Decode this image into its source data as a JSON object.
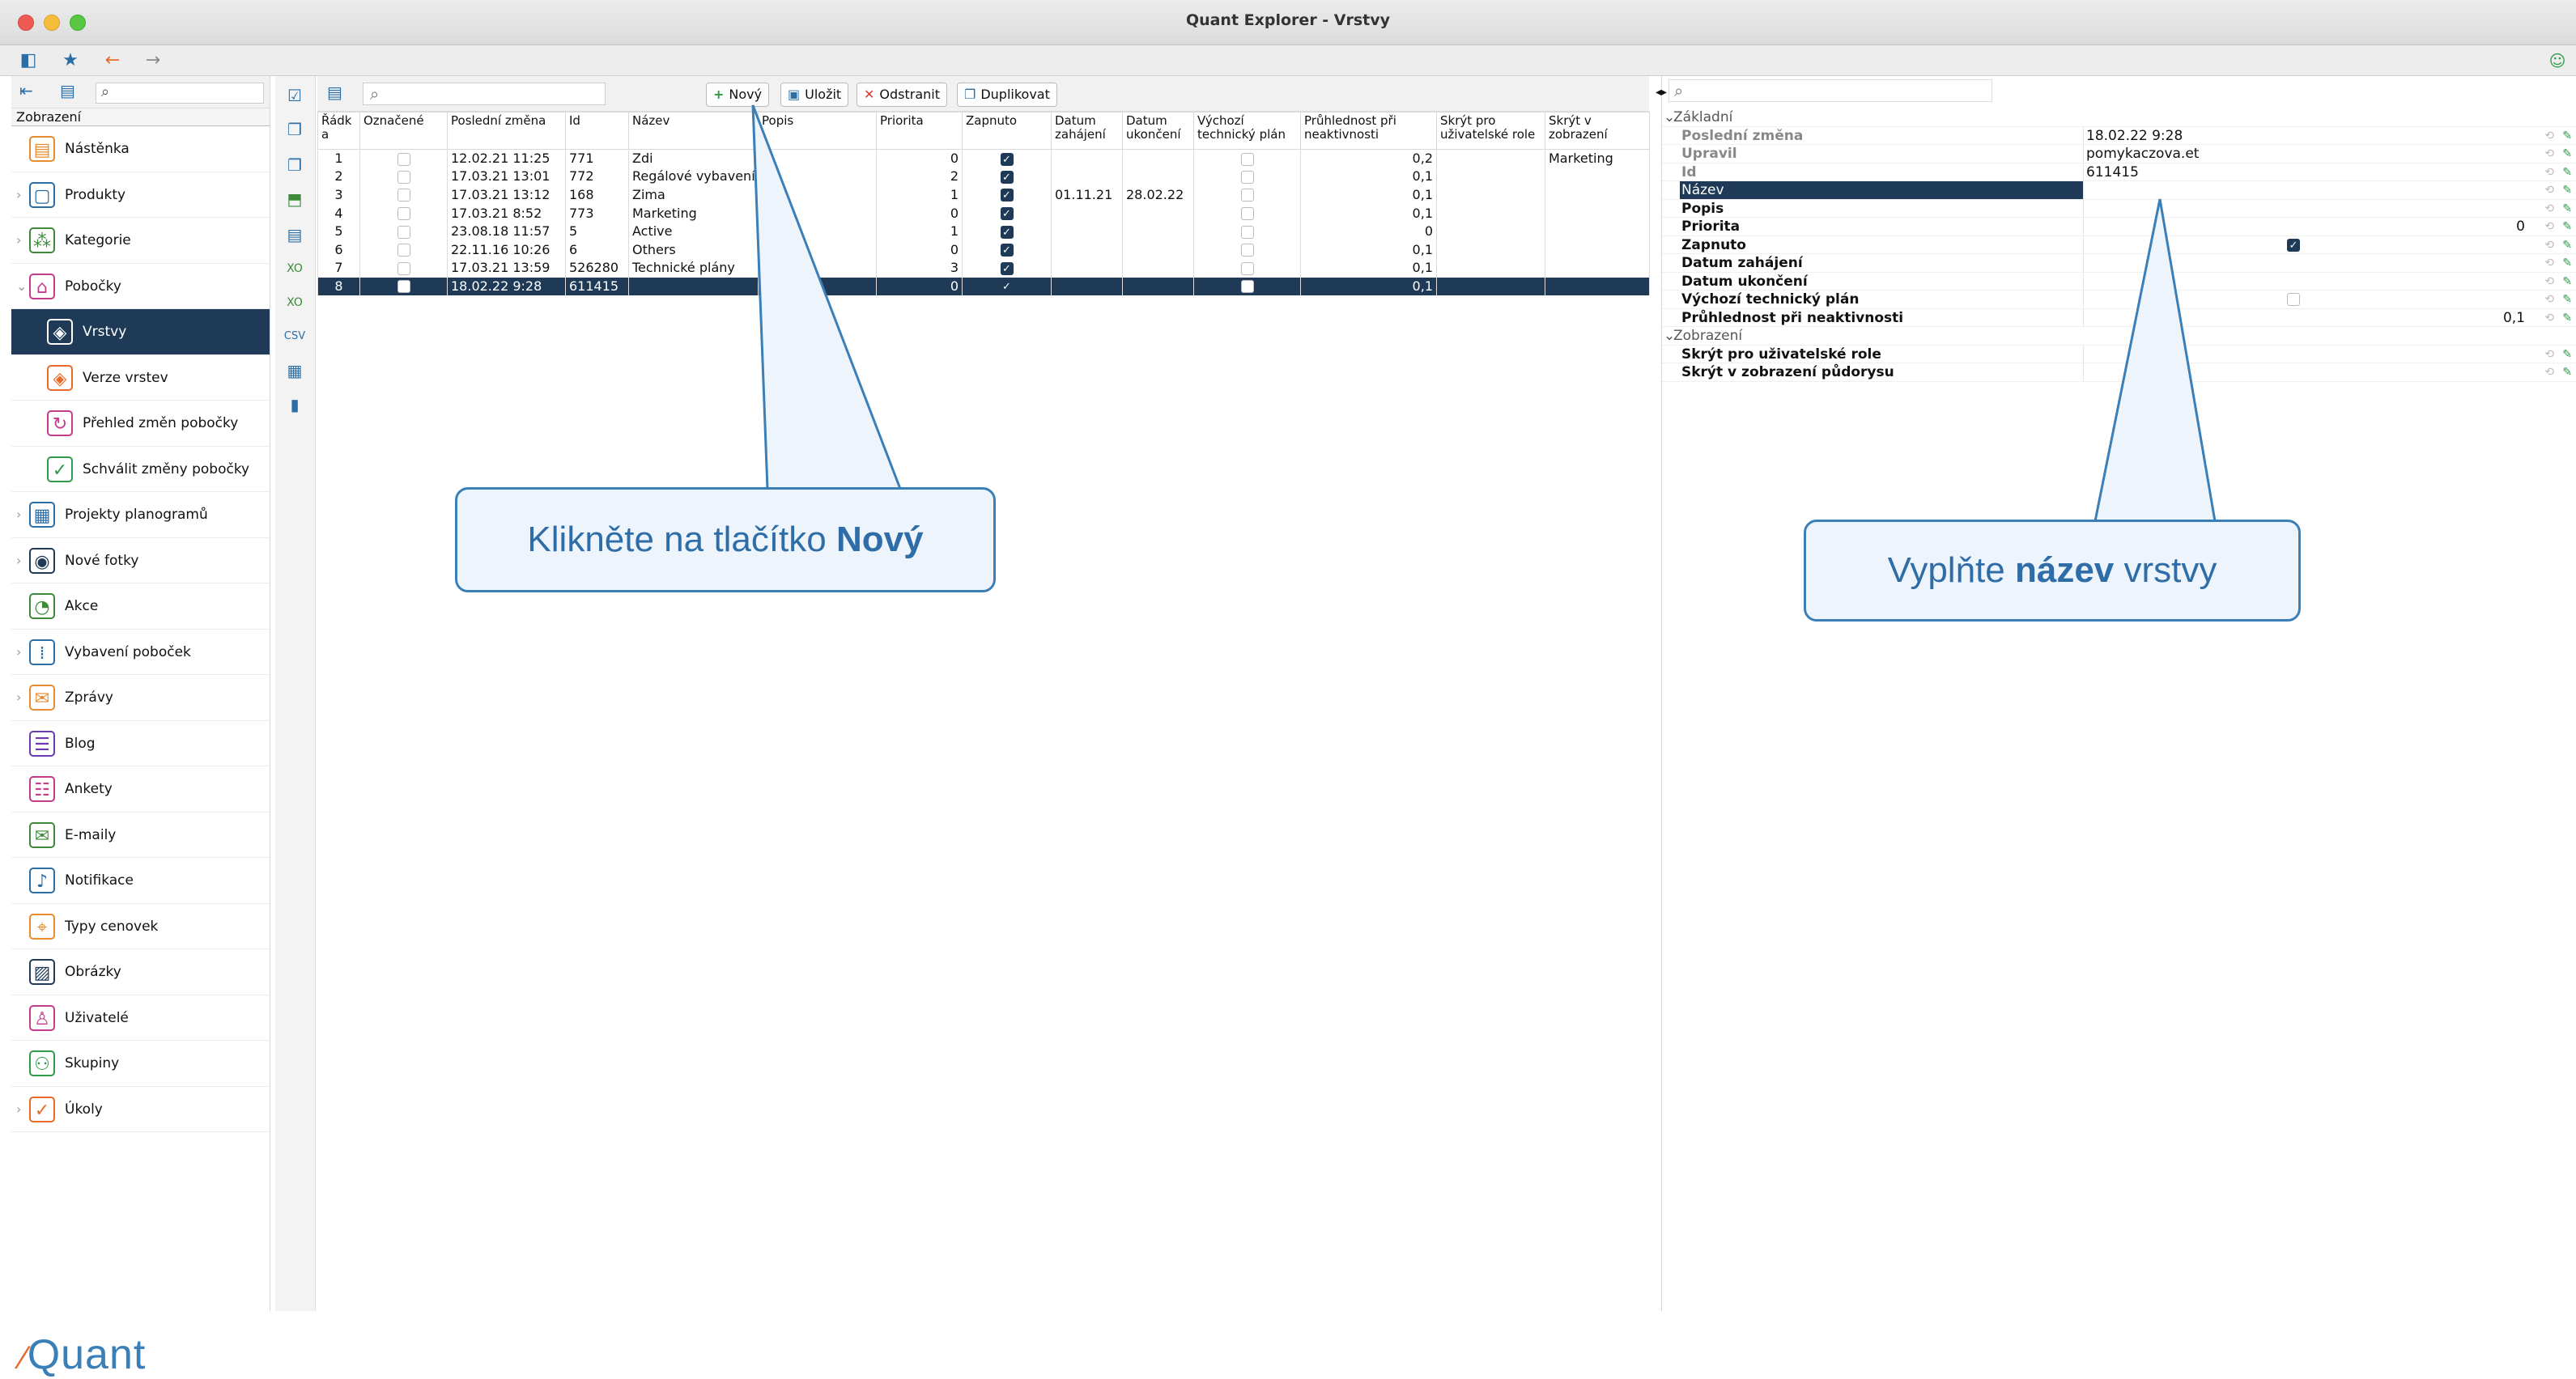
{
  "window": {
    "title": "Quant Explorer - Vrstvy"
  },
  "sidebar": {
    "section_label": "Zobrazení",
    "items": [
      {
        "label": "Nástěnka",
        "icon": "dashboard-icon",
        "glyph": "▤",
        "color": "#e88b2c",
        "level": 0,
        "chevron": ""
      },
      {
        "label": "Produkty",
        "icon": "box-icon",
        "glyph": "▢",
        "color": "#2b6ea6",
        "level": 0,
        "chevron": "›"
      },
      {
        "label": "Kategorie",
        "icon": "categories-icon",
        "glyph": "⁂",
        "color": "#3d8a3a",
        "level": 0,
        "chevron": "›"
      },
      {
        "label": "Pobočky",
        "icon": "store-icon",
        "glyph": "⌂",
        "color": "#c43b8c",
        "level": 0,
        "chevron": "⌄"
      },
      {
        "label": "Vrstvy",
        "icon": "layers-icon",
        "glyph": "◈",
        "color": "#e86a2a",
        "level": 1,
        "chevron": "",
        "selected": true
      },
      {
        "label": "Verze vrstev",
        "icon": "layer-versions-icon",
        "glyph": "◈",
        "color": "#e86a2a",
        "level": 1,
        "chevron": ""
      },
      {
        "label": "Přehled změn pobočky",
        "icon": "store-changes-icon",
        "glyph": "↻",
        "color": "#c43b8c",
        "level": 1,
        "chevron": ""
      },
      {
        "label": "Schválit změny pobočky",
        "icon": "approve-changes-icon",
        "glyph": "✓",
        "color": "#2f9a4a",
        "level": 1,
        "chevron": ""
      },
      {
        "label": "Projekty planogramů",
        "icon": "planogram-icon",
        "glyph": "▦",
        "color": "#2b6ea6",
        "level": 0,
        "chevron": "›"
      },
      {
        "label": "Nové fotky",
        "icon": "camera-icon",
        "glyph": "◉",
        "color": "#1e3a56",
        "level": 0,
        "chevron": "›"
      },
      {
        "label": "Akce",
        "icon": "promo-icon",
        "glyph": "◔",
        "color": "#3d8a3a",
        "level": 0,
        "chevron": ""
      },
      {
        "label": "Vybavení poboček",
        "icon": "equipment-icon",
        "glyph": "⁞",
        "color": "#2b6ea6",
        "level": 0,
        "chevron": "›"
      },
      {
        "label": "Zprávy",
        "icon": "messages-icon",
        "glyph": "✉",
        "color": "#e88b2c",
        "level": 0,
        "chevron": "›"
      },
      {
        "label": "Blog",
        "icon": "blog-icon",
        "glyph": "☰",
        "color": "#6b3ab0",
        "level": 0,
        "chevron": ""
      },
      {
        "label": "Ankety",
        "icon": "survey-icon",
        "glyph": "☷",
        "color": "#c43b8c",
        "level": 0,
        "chevron": ""
      },
      {
        "label": "E-maily",
        "icon": "email-icon",
        "glyph": "✉",
        "color": "#3d8a3a",
        "level": 0,
        "chevron": ""
      },
      {
        "label": "Notifikace",
        "icon": "bell-icon",
        "glyph": "♪",
        "color": "#2b6ea6",
        "level": 0,
        "chevron": ""
      },
      {
        "label": "Typy cenovek",
        "icon": "price-tag-icon",
        "glyph": "⌖",
        "color": "#e88b2c",
        "level": 0,
        "chevron": ""
      },
      {
        "label": "Obrázky",
        "icon": "image-icon",
        "glyph": "▨",
        "color": "#1e3a56",
        "level": 0,
        "chevron": ""
      },
      {
        "label": "Uživatelé",
        "icon": "user-icon",
        "glyph": "♙",
        "color": "#c43b8c",
        "level": 0,
        "chevron": ""
      },
      {
        "label": "Skupiny",
        "icon": "group-icon",
        "glyph": "⚇",
        "color": "#2f9a4a",
        "level": 0,
        "chevron": ""
      },
      {
        "label": "Úkoly",
        "icon": "tasks-icon",
        "glyph": "✓",
        "color": "#e86a2a",
        "level": 0,
        "chevron": "›"
      }
    ],
    "logo": "Quant"
  },
  "main": {
    "toolbar": {
      "new_label": "Nový",
      "save_label": "Uložit",
      "delete_label": "Odstranit",
      "duplicate_label": "Duplikovat"
    },
    "columns": [
      "Řádk a",
      "Označené",
      "Poslední změna",
      "Id",
      "Název",
      "Popis",
      "Priorita",
      "Zapnuto",
      "Datum zahájení",
      "Datum ukončení",
      "Výchozí technický plán",
      "Průhlednost při neaktivnosti",
      "Skrýt pro uživatelské role",
      "Skrýt v zobrazení"
    ],
    "rows": [
      {
        "row": "1",
        "modified": "12.02.21 11:25",
        "id": "771",
        "name": "Zdi",
        "desc": "",
        "priority": "0",
        "on": true,
        "start": "",
        "end": "",
        "opacity": "0,2",
        "hide_roles": "",
        "hide_view": "Marketing"
      },
      {
        "row": "2",
        "modified": "17.03.21 13:01",
        "id": "772",
        "name": "Regálové vybavení",
        "desc": "",
        "priority": "2",
        "on": true,
        "start": "",
        "end": "",
        "opacity": "0,1",
        "hide_roles": "",
        "hide_view": ""
      },
      {
        "row": "3",
        "modified": "17.03.21 13:12",
        "id": "168",
        "name": "Zima",
        "desc": "",
        "priority": "1",
        "on": true,
        "start": "01.11.21",
        "end": "28.02.22",
        "opacity": "0,1",
        "hide_roles": "",
        "hide_view": ""
      },
      {
        "row": "4",
        "modified": "17.03.21 8:52",
        "id": "773",
        "name": "Marketing",
        "desc": "",
        "priority": "0",
        "on": true,
        "start": "",
        "end": "",
        "opacity": "0,1",
        "hide_roles": "",
        "hide_view": ""
      },
      {
        "row": "5",
        "modified": "23.08.18 11:57",
        "id": "5",
        "name": "Active",
        "desc": "",
        "priority": "1",
        "on": true,
        "start": "",
        "end": "",
        "opacity": "0",
        "hide_roles": "",
        "hide_view": ""
      },
      {
        "row": "6",
        "modified": "22.11.16 10:26",
        "id": "6",
        "name": "Others",
        "desc": "",
        "priority": "0",
        "on": true,
        "start": "",
        "end": "",
        "opacity": "0,1",
        "hide_roles": "",
        "hide_view": ""
      },
      {
        "row": "7",
        "modified": "17.03.21 13:59",
        "id": "526280",
        "name": "Technické plány",
        "desc": "",
        "priority": "3",
        "on": true,
        "start": "",
        "end": "",
        "opacity": "0,1",
        "hide_roles": "",
        "hide_view": ""
      },
      {
        "row": "8",
        "modified": "18.02.22 9:28",
        "id": "611415",
        "name": "",
        "desc": "",
        "priority": "0",
        "on": true,
        "start": "",
        "end": "",
        "opacity": "0,1",
        "hide_roles": "",
        "hide_view": "",
        "selected": true
      }
    ]
  },
  "properties": {
    "group_basic": "Základní",
    "group_view": "Zobrazení",
    "rows": [
      {
        "label": "Poslední změna",
        "value": "18.02.22 9:28",
        "style": "grey"
      },
      {
        "label": "Upravil",
        "value": "pomykaczova.et",
        "style": "grey"
      },
      {
        "label": "Id",
        "value": "611415",
        "style": "grey"
      },
      {
        "label": "Název",
        "value": "",
        "style": "selrow"
      },
      {
        "label": "Popis",
        "value": "",
        "style": "bold"
      },
      {
        "label": "Priorita",
        "value": "0",
        "style": "bold",
        "align": "right"
      },
      {
        "label": "Zapnuto",
        "value": "",
        "style": "bold",
        "checkbox": "on"
      },
      {
        "label": "Datum zahájení",
        "value": "",
        "style": "bold"
      },
      {
        "label": "Datum ukončení",
        "value": "",
        "style": "bold"
      },
      {
        "label": "Výchozí technický plán",
        "value": "",
        "style": "bold",
        "checkbox": "off"
      },
      {
        "label": "Průhlednost při neaktivnosti",
        "value": "0,1",
        "style": "bold",
        "align": "right"
      }
    ],
    "view_rows": [
      {
        "label": "Skrýt pro uživatelské role",
        "value": ""
      },
      {
        "label": "Skrýt v zobrazení půdorysu",
        "value": ""
      }
    ]
  },
  "callouts": {
    "left_prefix": "Klikněte na tlačítko ",
    "left_bold": "Nový",
    "right_prefix": "Vyplňte ",
    "right_bold": "název",
    "right_suffix": " vrstvy"
  }
}
